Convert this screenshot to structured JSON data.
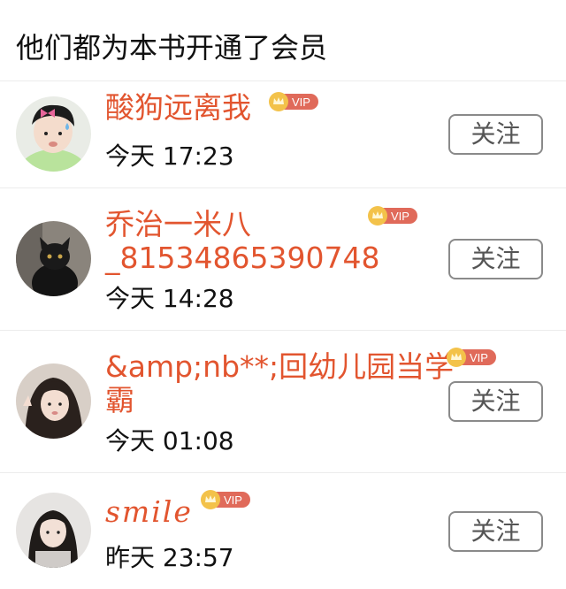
{
  "page_title": "他们都为本书开通了会员",
  "vip_label": "VIP",
  "follow_label": "关注",
  "members": [
    {
      "name_line1": "酸狗远离我",
      "name_line2": "",
      "time": "今天 17:23"
    },
    {
      "name_line1": "乔治一米八",
      "name_line2": "_81534865390748",
      "time": "今天 14:28"
    },
    {
      "name_line1": "&amp;nb**;回幼儿园当学",
      "name_line2": "霸",
      "time": "今天 01:08"
    },
    {
      "name_line1": "smile",
      "name_line2": "",
      "time": "昨天 23:57"
    }
  ],
  "colors": {
    "name": "#e2552f",
    "vip_badge": "#e06a5a",
    "crown": "#f3c24a",
    "divider": "#ececec",
    "button_border": "#8a8a8a"
  }
}
